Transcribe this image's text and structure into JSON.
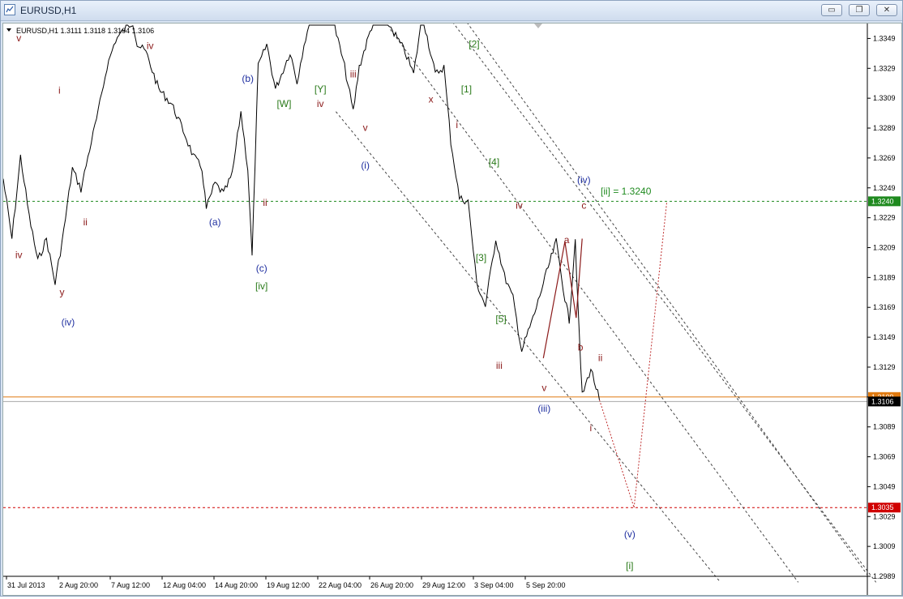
{
  "window": {
    "title": "EURUSD,H1"
  },
  "window_buttons": {
    "minimize": "▭",
    "restore": "❐",
    "close": "✕"
  },
  "chart_header": "EURUSD,H1  1.3111 1.3118 1.3104 1.3106",
  "target_annotation": "[ii] = 1.3240",
  "colors": {
    "bull": "#000000",
    "wave_red": "#8b1a1a",
    "wave_blue": "#1f2fa0",
    "wave_green": "#2a7a1a",
    "level_green": "#1f8a1f",
    "level_red": "#d00000",
    "current_line": "#e07a10"
  },
  "chart_data": {
    "type": "line",
    "symbol": "EURUSD",
    "timeframe": "H1",
    "ohlc_last": {
      "open": 1.3111,
      "high": 1.3118,
      "low": 1.3104,
      "close": 1.3106
    },
    "ylim": [
      1.2989,
      1.3359
    ],
    "y_ticks": [
      1.3349,
      1.3329,
      1.3309,
      1.3289,
      1.3269,
      1.3249,
      1.3229,
      1.3209,
      1.3189,
      1.3169,
      1.3149,
      1.3129,
      1.3109,
      1.3089,
      1.3069,
      1.3049,
      1.3029,
      1.3009,
      1.2989
    ],
    "x_ticks": [
      "31 Jul 2013",
      "2 Aug 20:00",
      "7 Aug 12:00",
      "12 Aug 04:00",
      "14 Aug 20:00",
      "19 Aug 12:00",
      "22 Aug 04:00",
      "26 Aug 20:00",
      "29 Aug 12:00",
      "3 Sep 04:00",
      "5 Sep 20:00"
    ],
    "price_labels": [
      {
        "value": 1.324,
        "label": "1.3240",
        "kind": "green"
      },
      {
        "value": 1.3109,
        "label": "1.3109",
        "kind": "orange"
      },
      {
        "value": 1.3106,
        "label": "1.3106",
        "kind": "current"
      },
      {
        "value": 1.3035,
        "label": "1.3035",
        "kind": "red"
      }
    ],
    "levels": [
      {
        "value": 1.324,
        "style": "green-dashed"
      },
      {
        "value": 1.3035,
        "style": "red-dashed"
      },
      {
        "value": 1.3109,
        "style": "orange-solid"
      },
      {
        "value": 1.3106,
        "style": "grey-solid"
      }
    ],
    "price_series": [
      [
        0.0,
        1.3255
      ],
      [
        0.01,
        1.3215
      ],
      [
        0.02,
        1.327
      ],
      [
        0.03,
        1.323
      ],
      [
        0.04,
        1.32
      ],
      [
        0.05,
        1.3215
      ],
      [
        0.06,
        1.3185
      ],
      [
        0.07,
        1.322
      ],
      [
        0.08,
        1.3262
      ],
      [
        0.09,
        1.3248
      ],
      [
        0.1,
        1.3275
      ],
      [
        0.11,
        1.33
      ],
      [
        0.12,
        1.333
      ],
      [
        0.13,
        1.3348
      ],
      [
        0.14,
        1.3355
      ],
      [
        0.15,
        1.336
      ],
      [
        0.155,
        1.3345
      ],
      [
        0.165,
        1.334
      ],
      [
        0.18,
        1.3315
      ],
      [
        0.195,
        1.3305
      ],
      [
        0.21,
        1.3285
      ],
      [
        0.22,
        1.327
      ],
      [
        0.23,
        1.3262
      ],
      [
        0.235,
        1.3235
      ],
      [
        0.245,
        1.3252
      ],
      [
        0.255,
        1.3245
      ],
      [
        0.265,
        1.3258
      ],
      [
        0.275,
        1.33
      ],
      [
        0.283,
        1.3262
      ],
      [
        0.288,
        1.3203
      ],
      [
        0.295,
        1.333
      ],
      [
        0.305,
        1.3345
      ],
      [
        0.315,
        1.3315
      ],
      [
        0.322,
        1.3325
      ],
      [
        0.332,
        1.334
      ],
      [
        0.34,
        1.332
      ],
      [
        0.348,
        1.3345
      ],
      [
        0.36,
        1.337
      ],
      [
        0.38,
        1.3365
      ],
      [
        0.395,
        1.333
      ],
      [
        0.405,
        1.33
      ],
      [
        0.412,
        1.333
      ],
      [
        0.428,
        1.336
      ],
      [
        0.445,
        1.336
      ],
      [
        0.465,
        1.334
      ],
      [
        0.475,
        1.3325
      ],
      [
        0.485,
        1.3365
      ],
      [
        0.5,
        1.3325
      ],
      [
        0.51,
        1.333
      ],
      [
        0.518,
        1.328
      ],
      [
        0.528,
        1.3242
      ],
      [
        0.538,
        1.324
      ],
      [
        0.548,
        1.3185
      ],
      [
        0.558,
        1.317
      ],
      [
        0.57,
        1.3215
      ],
      [
        0.58,
        1.319
      ],
      [
        0.59,
        1.3175
      ],
      [
        0.6,
        1.314
      ],
      [
        0.615,
        1.3165
      ],
      [
        0.625,
        1.3185
      ],
      [
        0.64,
        1.3213
      ],
      [
        0.65,
        1.3175
      ],
      [
        0.655,
        1.316
      ],
      [
        0.662,
        1.3215
      ],
      [
        0.665,
        1.317
      ],
      [
        0.67,
        1.311
      ],
      [
        0.68,
        1.3128
      ],
      [
        0.69,
        1.3107
      ]
    ],
    "projection": {
      "down": [
        [
          0.69,
          1.3107
        ],
        [
          0.73,
          1.3035
        ]
      ],
      "up": [
        [
          0.73,
          1.3035
        ],
        [
          0.768,
          1.324
        ]
      ]
    },
    "channel_lines": [
      [
        [
          0.385,
          1.33
        ],
        [
          0.83,
          1.2985
        ]
      ],
      [
        [
          0.448,
          1.3355
        ],
        [
          0.92,
          1.2985
        ]
      ],
      [
        [
          0.52,
          1.336
        ],
        [
          1.01,
          1.2985
        ]
      ],
      [
        [
          0.53,
          1.3365
        ],
        [
          1.0,
          1.299
        ]
      ]
    ],
    "wave_lines": [
      [
        [
          0.625,
          1.3135
        ],
        [
          0.65,
          1.3213
        ],
        [
          0.663,
          1.3162
        ],
        [
          0.67,
          1.3215
        ]
      ]
    ],
    "wave_labels": [
      {
        "x": 0.018,
        "y": 1.3347,
        "text": "v",
        "color": "red"
      },
      {
        "x": 0.065,
        "y": 1.3312,
        "text": "i",
        "color": "red"
      },
      {
        "x": 0.17,
        "y": 1.3342,
        "text": "iv",
        "color": "red"
      },
      {
        "x": 0.095,
        "y": 1.3224,
        "text": "ii",
        "color": "red"
      },
      {
        "x": 0.018,
        "y": 1.3202,
        "text": "iv",
        "color": "red"
      },
      {
        "x": 0.068,
        "y": 1.3177,
        "text": "y",
        "color": "red"
      },
      {
        "x": 0.075,
        "y": 1.3157,
        "text": "(iv)",
        "color": "blue"
      },
      {
        "x": 0.245,
        "y": 1.3224,
        "text": "(a)",
        "color": "blue"
      },
      {
        "x": 0.283,
        "y": 1.332,
        "text": "(b)",
        "color": "blue"
      },
      {
        "x": 0.303,
        "y": 1.3237,
        "text": "ii",
        "color": "red"
      },
      {
        "x": 0.299,
        "y": 1.3193,
        "text": "(c)",
        "color": "blue"
      },
      {
        "x": 0.299,
        "y": 1.3181,
        "text": "[iv]",
        "color": "green"
      },
      {
        "x": 0.325,
        "y": 1.3303,
        "text": "[W]",
        "color": "green"
      },
      {
        "x": 0.367,
        "y": 1.3313,
        "text": "[Y]",
        "color": "green"
      },
      {
        "x": 0.367,
        "y": 1.3303,
        "text": "iv",
        "color": "red"
      },
      {
        "x": 0.405,
        "y": 1.3323,
        "text": "iii",
        "color": "red"
      },
      {
        "x": 0.419,
        "y": 1.3287,
        "text": "v",
        "color": "red"
      },
      {
        "x": 0.419,
        "y": 1.3262,
        "text": "(i)",
        "color": "blue"
      },
      {
        "x": 0.495,
        "y": 1.3306,
        "text": "x",
        "color": "red"
      },
      {
        "x": 0.545,
        "y": 1.3343,
        "text": "[2]",
        "color": "green"
      },
      {
        "x": 0.536,
        "y": 1.3313,
        "text": "[1]",
        "color": "green"
      },
      {
        "x": 0.525,
        "y": 1.3289,
        "text": "i",
        "color": "red"
      },
      {
        "x": 0.568,
        "y": 1.3264,
        "text": "[4]",
        "color": "green"
      },
      {
        "x": 0.597,
        "y": 1.3235,
        "text": "iv",
        "color": "red"
      },
      {
        "x": 0.553,
        "y": 1.32,
        "text": "[3]",
        "color": "green"
      },
      {
        "x": 0.576,
        "y": 1.3159,
        "text": "[5]",
        "color": "green"
      },
      {
        "x": 0.574,
        "y": 1.3128,
        "text": "iii",
        "color": "red"
      },
      {
        "x": 0.626,
        "y": 1.3113,
        "text": "v",
        "color": "red"
      },
      {
        "x": 0.626,
        "y": 1.3099,
        "text": "(iii)",
        "color": "blue"
      },
      {
        "x": 0.672,
        "y": 1.3252,
        "text": "(iv)",
        "color": "blue"
      },
      {
        "x": 0.672,
        "y": 1.3235,
        "text": "c",
        "color": "red"
      },
      {
        "x": 0.652,
        "y": 1.3212,
        "text": "a",
        "color": "red"
      },
      {
        "x": 0.668,
        "y": 1.314,
        "text": "b",
        "color": "red"
      },
      {
        "x": 0.691,
        "y": 1.3133,
        "text": "ii",
        "color": "red"
      },
      {
        "x": 0.68,
        "y": 1.3086,
        "text": "i",
        "color": "red"
      },
      {
        "x": 0.725,
        "y": 1.3015,
        "text": "(v)",
        "color": "blue"
      },
      {
        "x": 0.725,
        "y": 1.2994,
        "text": "[i]",
        "color": "green"
      }
    ]
  }
}
